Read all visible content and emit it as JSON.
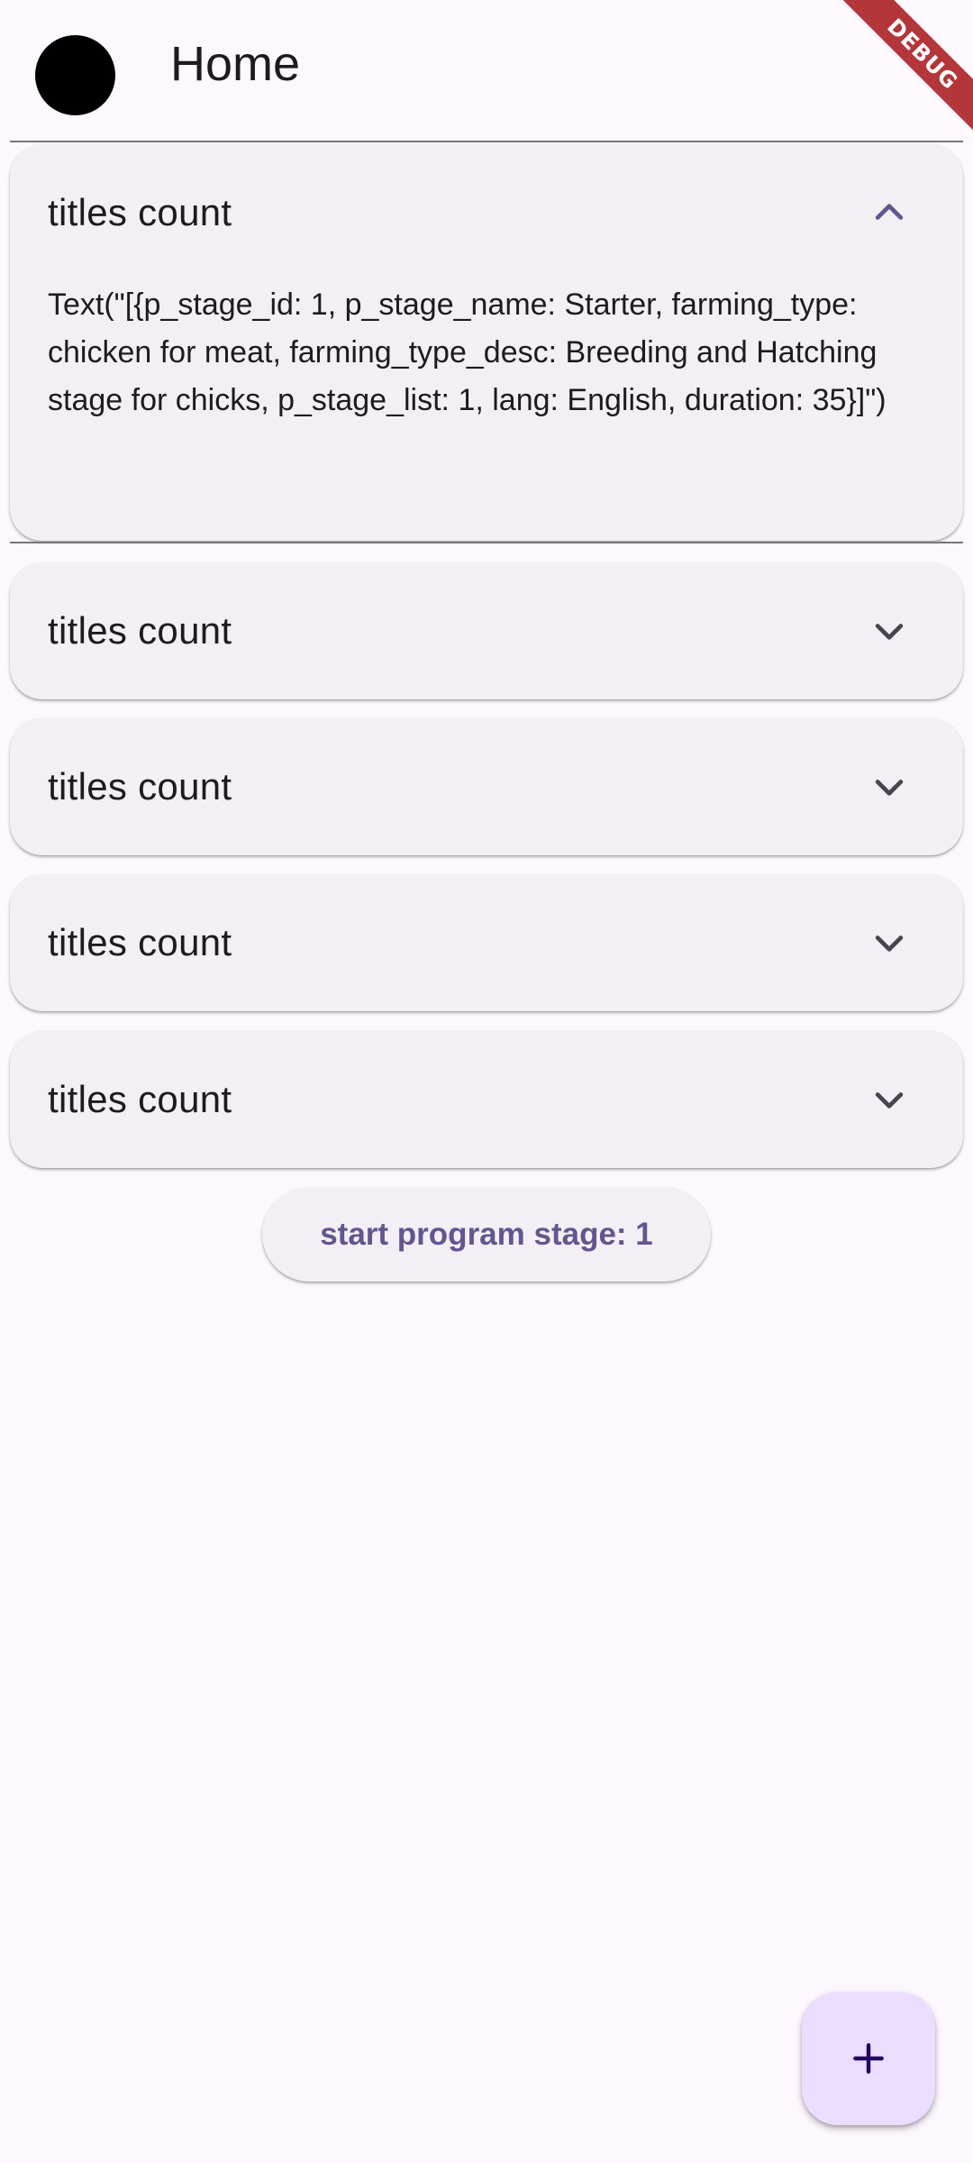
{
  "appbar": {
    "title": "Home",
    "debug_label": "DEBUG"
  },
  "panels": [
    {
      "title": "titles count",
      "expanded": true,
      "body": "Text(\"[{p_stage_id: 1, p_stage_name: Starter, farming_type: chicken for meat, farming_type_desc: Breeding and Hatching stage for chicks, p_stage_list: 1, lang: English, duration: 35}]\")"
    },
    {
      "title": "titles count",
      "expanded": false
    },
    {
      "title": "titles count",
      "expanded": false
    },
    {
      "title": "titles count",
      "expanded": false
    },
    {
      "title": "titles count",
      "expanded": false
    }
  ],
  "start_button": {
    "label": "start program stage: 1"
  },
  "fab": {
    "icon": "plus-icon"
  },
  "colors": {
    "background": "#fdf7fe",
    "panel": "#f4eff4",
    "accent": "#65558f",
    "fab": "#eaddff",
    "debug_banner": "#b3363a"
  }
}
